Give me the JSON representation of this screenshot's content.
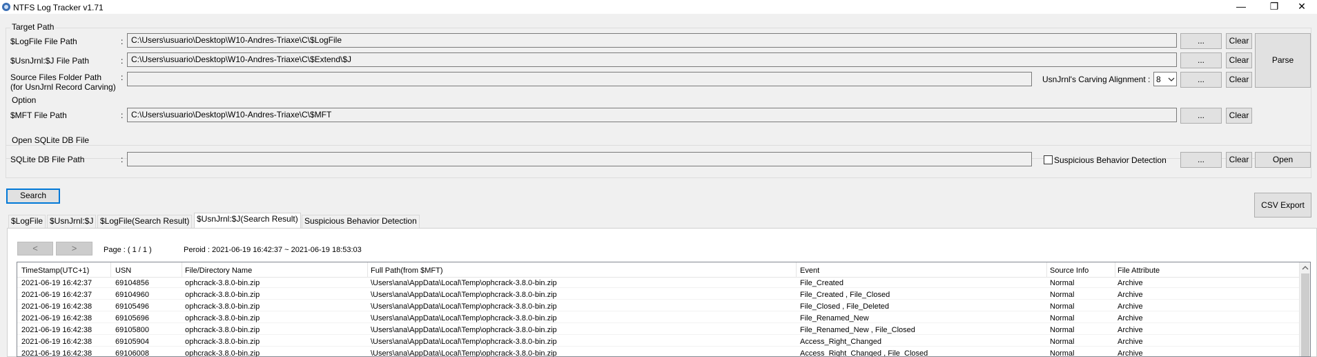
{
  "window": {
    "title": "NTFS Log Tracker v1.71",
    "minimize": "—",
    "restore": "❐",
    "close": "✕"
  },
  "target_path": {
    "legend": "Target Path",
    "logfile": {
      "label": "$LogFile File Path",
      "value": "C:\\Users\\usuario\\Desktop\\W10-Andres-Triaxe\\C\\$LogFile"
    },
    "usnjrnl": {
      "label": "$UsnJrnl:$J File Path",
      "value": "C:\\Users\\usuario\\Desktop\\W10-Andres-Triaxe\\C\\$Extend\\$J"
    },
    "source_folder": {
      "label": "Source Files Folder Path",
      "label2": "(for UsnJrnl Record Carving)",
      "value": ""
    },
    "carving_label": "UsnJrnl's Carving Alignment :",
    "carving_value": "8"
  },
  "option": {
    "legend": "Option",
    "mft": {
      "label": "$MFT File Path",
      "value": "C:\\Users\\usuario\\Desktop\\W10-Andres-Triaxe\\C\\$MFT"
    }
  },
  "sqlite": {
    "legend": "Open SQLite DB File",
    "label": "SQLite DB File Path",
    "value": "",
    "suspicious_label": "Suspicious Behavior Detection"
  },
  "buttons": {
    "browse": "...",
    "clear": "Clear",
    "parse": "Parse",
    "open": "Open",
    "search": "Search",
    "csv_export": "CSV Export",
    "prev": "<",
    "next": ">"
  },
  "colon": ":",
  "tabs": [
    "$LogFile",
    "$UsnJrnl:$J",
    "$LogFile(Search Result)",
    "$UsnJrnl:$J(Search Result)",
    "Suspicious Behavior Detection"
  ],
  "pager": {
    "page": "Page : ( 1 / 1 )",
    "period": "Peroid :  2021-06-19 16:42:37 ~ 2021-06-19 18:53:03"
  },
  "table": {
    "columns": [
      "TimeStamp(UTC+1)",
      "USN",
      "File/Directory Name",
      "Full Path(from $MFT)",
      "Event",
      "Source Info",
      "File Attribute"
    ],
    "rows": [
      [
        "2021-06-19 16:42:37",
        "69104856",
        "ophcrack-3.8.0-bin.zip",
        "\\Users\\ana\\AppData\\Local\\Temp\\ophcrack-3.8.0-bin.zip",
        "File_Created",
        "Normal",
        "Archive"
      ],
      [
        "2021-06-19 16:42:37",
        "69104960",
        "ophcrack-3.8.0-bin.zip",
        "\\Users\\ana\\AppData\\Local\\Temp\\ophcrack-3.8.0-bin.zip",
        "File_Created , File_Closed",
        "Normal",
        "Archive"
      ],
      [
        "2021-06-19 16:42:38",
        "69105496",
        "ophcrack-3.8.0-bin.zip",
        "\\Users\\ana\\AppData\\Local\\Temp\\ophcrack-3.8.0-bin.zip",
        "File_Closed , File_Deleted",
        "Normal",
        "Archive"
      ],
      [
        "2021-06-19 16:42:38",
        "69105696",
        "ophcrack-3.8.0-bin.zip",
        "\\Users\\ana\\AppData\\Local\\Temp\\ophcrack-3.8.0-bin.zip",
        "File_Renamed_New",
        "Normal",
        "Archive"
      ],
      [
        "2021-06-19 16:42:38",
        "69105800",
        "ophcrack-3.8.0-bin.zip",
        "\\Users\\ana\\AppData\\Local\\Temp\\ophcrack-3.8.0-bin.zip",
        "File_Renamed_New , File_Closed",
        "Normal",
        "Archive"
      ],
      [
        "2021-06-19 16:42:38",
        "69105904",
        "ophcrack-3.8.0-bin.zip",
        "\\Users\\ana\\AppData\\Local\\Temp\\ophcrack-3.8.0-bin.zip",
        "Access_Right_Changed",
        "Normal",
        "Archive"
      ],
      [
        "2021-06-19 16:42:38",
        "69106008",
        "ophcrack-3.8.0-bin.zip",
        "\\Users\\ana\\AppData\\Local\\Temp\\ophcrack-3.8.0-bin.zip",
        "Access_Right_Changed , File_Closed",
        "Normal",
        "Archive"
      ]
    ]
  }
}
